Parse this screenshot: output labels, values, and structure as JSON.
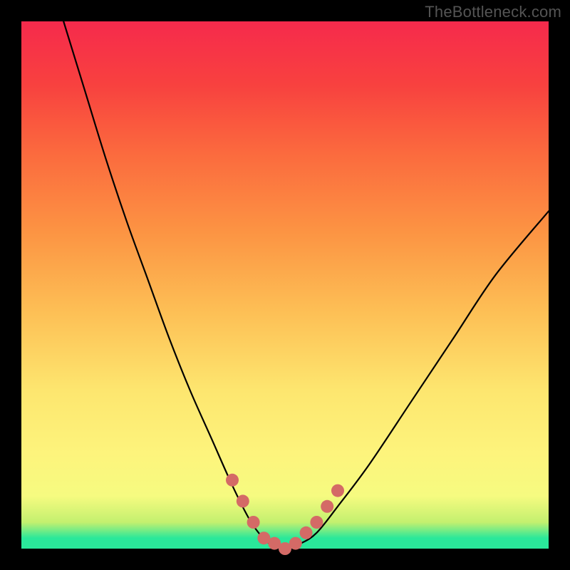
{
  "watermark": "TheBottleneck.com",
  "chart_data": {
    "type": "line",
    "title": "",
    "xlabel": "",
    "ylabel": "",
    "xlim": [
      0,
      1
    ],
    "ylim": [
      0,
      1
    ],
    "grid": false,
    "series": [
      {
        "name": "bottleneck-curve",
        "color": "#000000",
        "x": [
          0.08,
          0.12,
          0.16,
          0.2,
          0.24,
          0.28,
          0.32,
          0.36,
          0.4,
          0.43,
          0.45,
          0.47,
          0.5,
          0.53,
          0.56,
          0.6,
          0.66,
          0.74,
          0.82,
          0.9,
          1.0
        ],
        "y": [
          1.0,
          0.87,
          0.74,
          0.62,
          0.51,
          0.4,
          0.3,
          0.21,
          0.12,
          0.06,
          0.03,
          0.01,
          0.0,
          0.01,
          0.03,
          0.08,
          0.16,
          0.28,
          0.4,
          0.52,
          0.64
        ]
      }
    ],
    "markers": [
      {
        "name": "fit-region-dots",
        "color": "#d46a66",
        "x": [
          0.4,
          0.42,
          0.44,
          0.46,
          0.48,
          0.5,
          0.52,
          0.54,
          0.56,
          0.58,
          0.6
        ],
        "y": [
          0.13,
          0.09,
          0.05,
          0.02,
          0.01,
          0.0,
          0.01,
          0.03,
          0.05,
          0.08,
          0.11
        ]
      }
    ],
    "background_gradient": {
      "axis": "y",
      "stops": [
        {
          "y": 0.0,
          "color": "#2ae89a"
        },
        {
          "y": 0.1,
          "color": "#f6fb80"
        },
        {
          "y": 0.5,
          "color": "#fca448"
        },
        {
          "y": 1.0,
          "color": "#f62a4c"
        }
      ]
    }
  }
}
